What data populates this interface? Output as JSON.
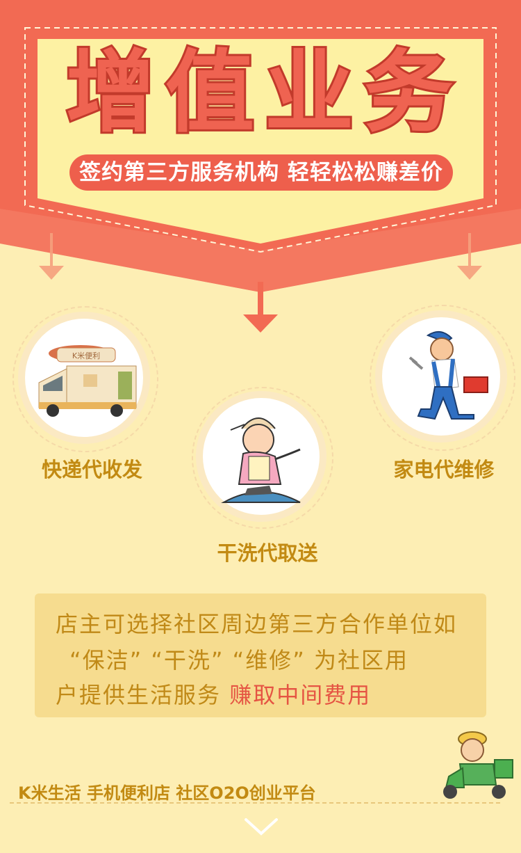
{
  "banner": {
    "title_chars": [
      "增",
      "值",
      "业",
      "务"
    ],
    "subtitle": "签约第三方服务机构  轻轻松松赚差价"
  },
  "services": [
    {
      "label": "快递代收发",
      "icon": "delivery-truck-icon",
      "truck_sign": "K米便利"
    },
    {
      "label": "干洗代取送",
      "icon": "ironing-woman-icon"
    },
    {
      "label": "家电代维修",
      "icon": "repairman-icon"
    }
  ],
  "info": {
    "line1": "店主可选择社区周边第三方合作单位如",
    "line2": "“保洁”  “干洗”  “维修”  为社区用",
    "line3_plain": "户提供生活服务 ",
    "line3_highlight": "赚取中间费用"
  },
  "footer": {
    "text": "K米生活    手机便利店    社区O2O创业平台",
    "mascot_icon": "scooter-courier-icon",
    "scroll_icon": "chevron-down-icon"
  },
  "colors": {
    "background": "#fdeeb4",
    "banner_red": "#f26a53",
    "banner_yellow": "#fdf1a3",
    "label_gold": "#c28a12",
    "highlight_red": "#e55443"
  }
}
